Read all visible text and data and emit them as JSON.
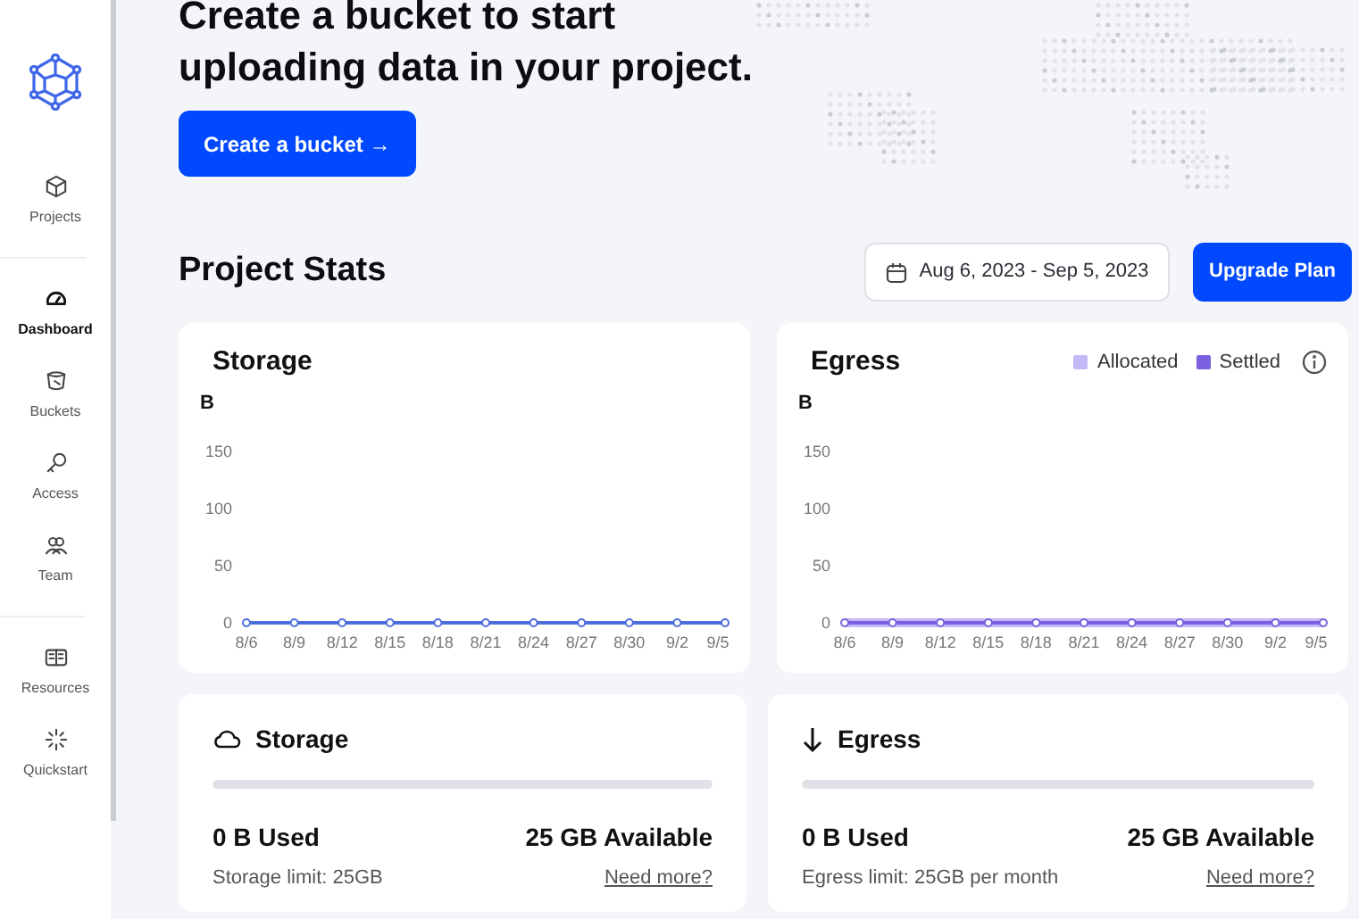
{
  "sidebar": {
    "sections": [
      {
        "items": [
          {
            "label": "Projects",
            "selected": false
          }
        ]
      },
      {
        "items": [
          {
            "label": "Dashboard",
            "selected": true
          },
          {
            "label": "Buckets",
            "selected": false
          },
          {
            "label": "Access",
            "selected": false
          },
          {
            "label": "Team",
            "selected": false
          }
        ]
      },
      {
        "items": [
          {
            "label": "Resources",
            "selected": false
          },
          {
            "label": "Quickstart",
            "selected": false
          }
        ]
      }
    ]
  },
  "banner": {
    "heading_lines": [
      "Create a bucket to start",
      "uploading data in your project."
    ],
    "button": "Create a bucket →"
  },
  "stats": {
    "title": "Project Stats",
    "date_range": "Aug 6, 2023 - Sep 5, 2023",
    "upgrade_button": "Upgrade Plan"
  },
  "charts": [
    {
      "title": "Storage",
      "chart_data": {
        "type": "line",
        "ylabel": "B",
        "categories": [
          "8/6",
          "8/9",
          "8/12",
          "8/15",
          "8/18",
          "8/21",
          "8/24",
          "8/27",
          "8/30",
          "9/2",
          "9/5"
        ],
        "series": [
          {
            "color": "#4c6fdc",
            "marker": "circle",
            "values": [
              0,
              0,
              0,
              0,
              0,
              0,
              0,
              0,
              0,
              0,
              0
            ]
          }
        ],
        "ylim": [
          0,
          150
        ],
        "yticks": [
          0,
          50,
          100,
          150
        ]
      }
    },
    {
      "title": "Egress",
      "chart_data": {
        "type": "line",
        "ylabel": "B",
        "categories": [
          "8/6",
          "8/9",
          "8/12",
          "8/15",
          "8/18",
          "8/21",
          "8/24",
          "8/27",
          "8/30",
          "9/2",
          "9/5"
        ],
        "series": [
          {
            "name": "Allocated",
            "color": "#c4b8f7",
            "values": [
              0,
              0,
              0,
              0,
              0,
              0,
              0,
              0,
              0,
              0,
              0
            ]
          },
          {
            "name": "Settled",
            "color": "#7b61e0",
            "marker": "circle",
            "values": [
              0,
              0,
              0,
              0,
              0,
              0,
              0,
              0,
              0,
              0,
              0
            ]
          }
        ],
        "ylim": [
          0,
          150
        ],
        "yticks": [
          0,
          50,
          100,
          150
        ]
      }
    }
  ],
  "usage": [
    {
      "kind": "storage",
      "title": "Storage",
      "level": 0,
      "used": "0 B Used",
      "available": "25 GB Available",
      "limit": "Storage limit: 25GB",
      "link": "Need more?"
    },
    {
      "kind": "egress",
      "title": "Egress",
      "level": 0,
      "used": "0 B Used",
      "available": "25 GB Available",
      "limit": "Egress limit: 25GB per month",
      "link": "Need more?"
    }
  ]
}
